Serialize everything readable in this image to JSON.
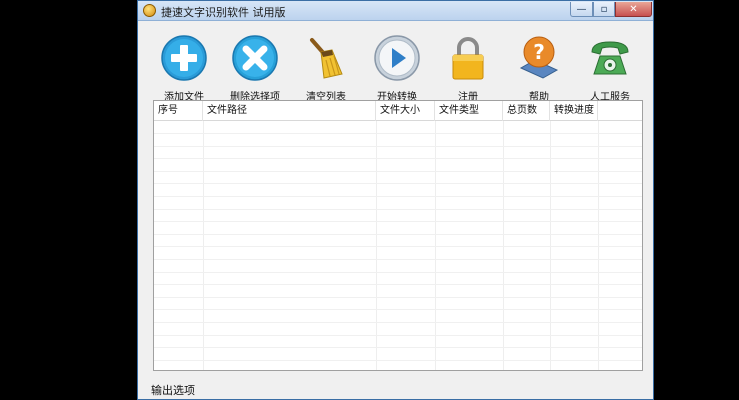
{
  "window": {
    "title": "捷速文字识别软件 试用版",
    "min_symbol": "—",
    "max_symbol": "▫",
    "close_symbol": "✕"
  },
  "toolbar": {
    "add_label": "添加文件",
    "delete_label": "删除选择项",
    "clear_label": "清空列表",
    "start_label": "开始转换",
    "register_label": "注册",
    "help_label": "帮助",
    "service_label": "人工服务"
  },
  "icons": {
    "add": "plus-circle-icon",
    "delete": "x-circle-icon",
    "clear": "broom-icon",
    "start": "play-icon",
    "register": "lock-icon",
    "help": "help-book-icon",
    "service": "telephone-icon"
  },
  "table": {
    "columns": [
      "序号",
      "文件路径",
      "文件大小",
      "文件类型",
      "总页数",
      "转换进度"
    ],
    "rows": []
  },
  "output": {
    "label": "输出选项"
  },
  "colors": {
    "title_bar": "#c9dcf2",
    "add_icon": "#2a9bd8",
    "delete_icon": "#27a0d8",
    "lock": "#f2b51e",
    "service_icon": "#3f9a4a"
  }
}
